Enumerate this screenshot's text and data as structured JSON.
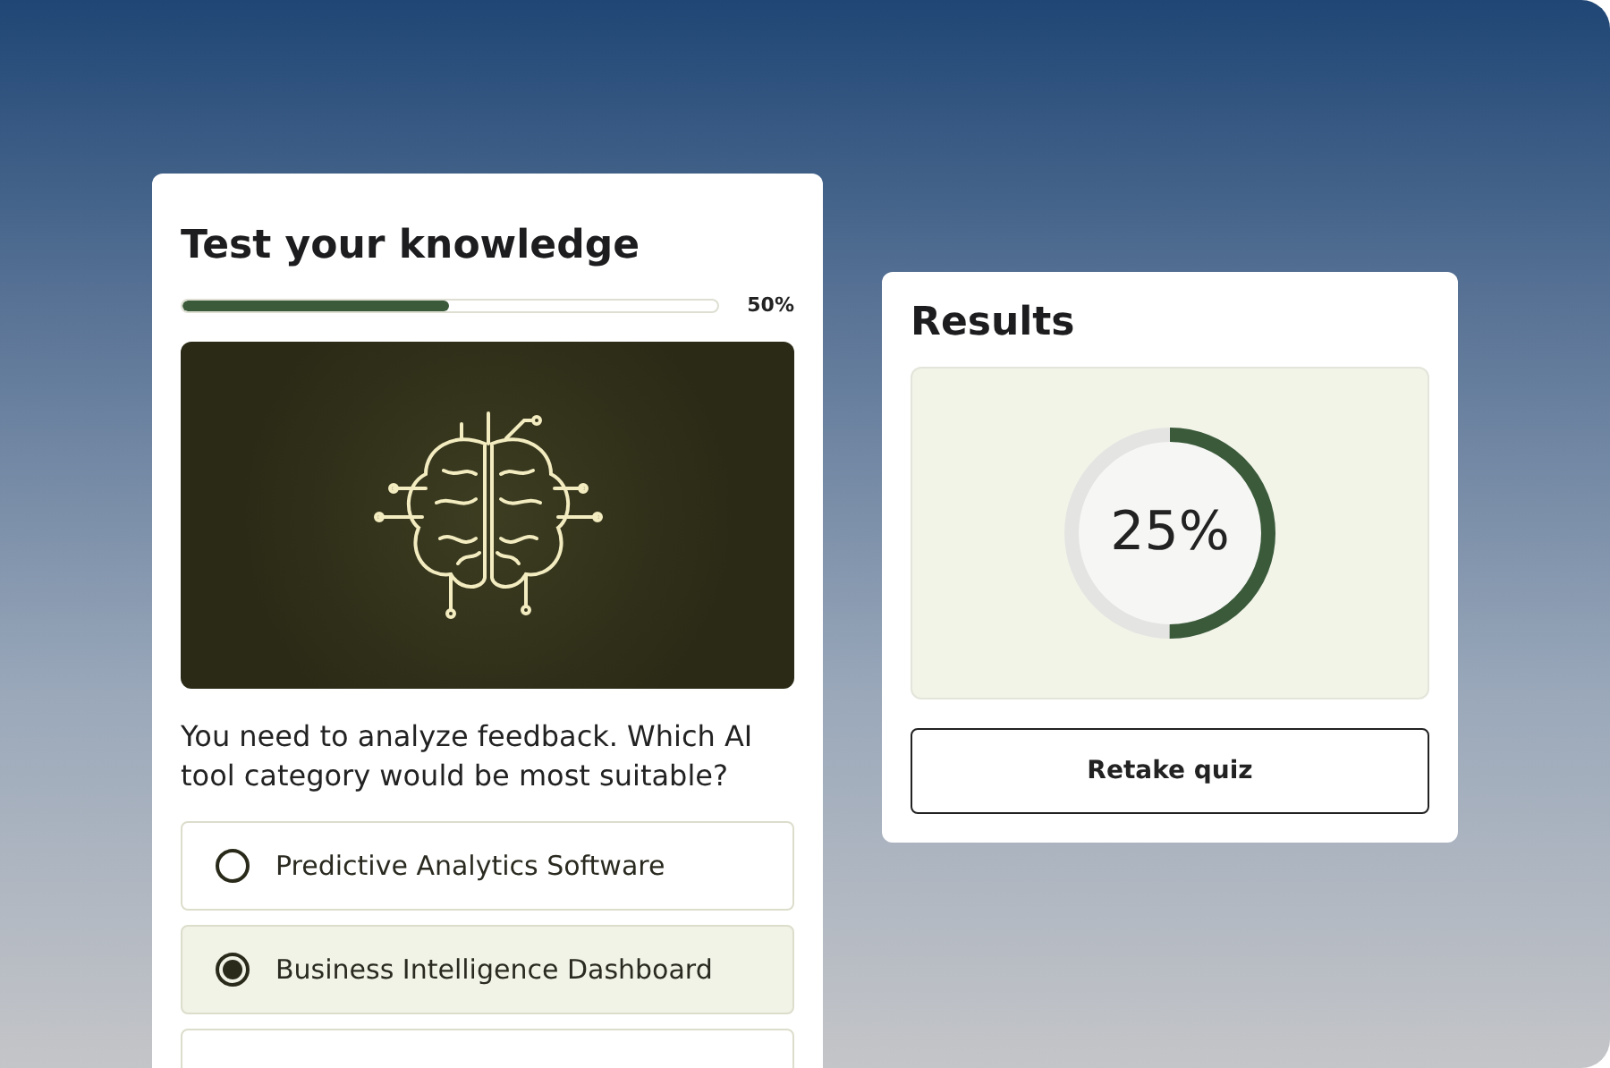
{
  "quiz": {
    "title": "Test your knowledge",
    "progress": {
      "level": 0.5,
      "reading": "50%"
    },
    "question": "You need to analyze feedback. Which AI tool category would be most suitable?",
    "options": [
      {
        "label": "Predictive Analytics Software",
        "selected": false
      },
      {
        "label": "Business Intelligence Dashboard",
        "selected": true
      }
    ]
  },
  "results": {
    "title": "Results",
    "score": {
      "level": 0.5,
      "reading": "25%"
    },
    "button": "Retake quiz"
  }
}
